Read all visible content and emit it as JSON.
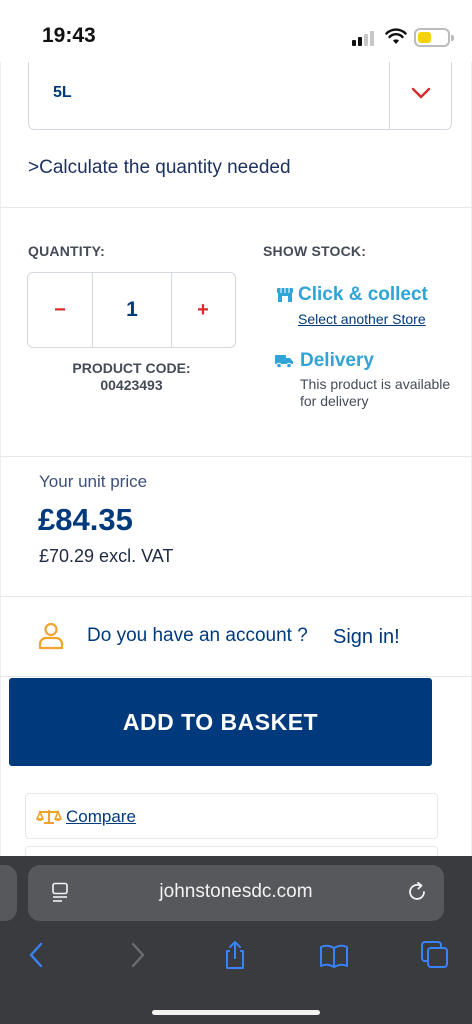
{
  "status_bar": {
    "time": "19:43"
  },
  "product": {
    "size_value": "5L",
    "calc_prefix": ">",
    "calc_link": "Calculate the quantity needed",
    "quantity_label": "QUANTITY:",
    "quantity_value": "1",
    "minus_label": "−",
    "plus_label": "+",
    "product_code_label": "PRODUCT CODE:",
    "product_code": "00423493",
    "show_stock_label": "SHOW STOCK:",
    "click_collect": "Click & collect",
    "select_store": "Select another Store",
    "delivery": "Delivery",
    "delivery_text": "This product is available for delivery"
  },
  "pricing": {
    "unit_label": "Your unit price",
    "price": "£84.35",
    "price_ex_vat": "£70.29 excl. VAT"
  },
  "account": {
    "question": "Do you have an account ?",
    "sign_in": "Sign in!"
  },
  "add_to_basket": "ADD TO BASKET",
  "compare": "Compare",
  "browser": {
    "url": "johnstonesdc.com"
  },
  "colors": {
    "brand_navy": "#003a7d",
    "accent_red": "#d92b2b",
    "accent_blue": "#2fa4d6",
    "accent_orange": "#f0a32a"
  },
  "icons": {
    "size_dropdown": "chevron-down-icon",
    "click_collect": "store-icon",
    "delivery": "truck-icon",
    "account": "user-icon",
    "compare": "scale-icon",
    "browser": [
      "page-icon",
      "reload-icon",
      "back-icon",
      "forward-icon",
      "share-icon",
      "bookmarks-icon",
      "tabs-icon"
    ]
  }
}
